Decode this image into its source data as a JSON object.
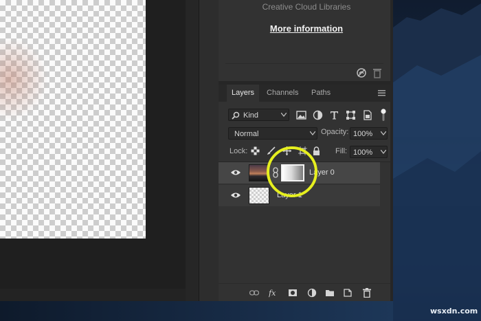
{
  "libraries": {
    "info_text": "Creative Cloud Libraries",
    "more_info_link": "More information"
  },
  "layers_panel": {
    "tabs": [
      {
        "label": "Layers",
        "active": true
      },
      {
        "label": "Channels",
        "active": false
      },
      {
        "label": "Paths",
        "active": false
      }
    ],
    "filter": {
      "kind_label": "Kind"
    },
    "blend_mode": "Normal",
    "opacity_label": "Opacity:",
    "opacity_value": "100%",
    "lock_label": "Lock:",
    "fill_label": "Fill:",
    "fill_value": "100%",
    "layers": [
      {
        "name": "Layer 0",
        "selected": true,
        "has_mask": true
      },
      {
        "name": "Layer 1",
        "selected": false,
        "has_mask": false
      }
    ]
  },
  "annotation": {
    "highlight_color": "#e6ef1f"
  },
  "watermark": "wsxdn.com",
  "colors": {
    "panel_bg": "#323232",
    "selected_row": "#464646"
  }
}
